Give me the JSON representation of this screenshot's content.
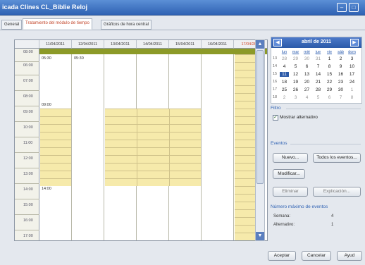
{
  "window": {
    "title": "icada Clines CL_Biblie Reloj"
  },
  "tabs": [
    {
      "label": "General"
    },
    {
      "label": "Tratamiento del módulo de tiempo"
    },
    {
      "label": "Gráficos de hora central"
    }
  ],
  "calendar": {
    "columns": [
      "11/04/2011",
      "12/04/2011",
      "13/04/2011",
      "14/04/2011",
      "15/04/2011",
      "16/04/2011",
      "17/04/2011"
    ],
    "hours": [
      "08:00",
      "06:00",
      "07:00",
      "08:00",
      "09:00",
      "10:00",
      "11:00",
      "12:00",
      "13:00",
      "14:00",
      "15:00",
      "16:00",
      "17:00"
    ],
    "events": {
      "mon_0530": "05:30",
      "tue_0530": "05:30",
      "mon_0900": "09:00",
      "mon_1400": "14:00"
    },
    "colors": {
      "work_band": "#f6eaab",
      "top_band": "#8c9a28",
      "today_header": "#d04020"
    }
  },
  "mini_calendar": {
    "title": "abril de 2011",
    "prev_icon": "chevron-left-icon",
    "next_icon": "chevron-right-icon",
    "weekdays": [
      "lun",
      "mar",
      "mié",
      "jue",
      "vie",
      "sáb",
      "dom"
    ],
    "weeks": [
      {
        "week": "13",
        "days": [
          "28",
          "29",
          "30",
          "31",
          "1",
          "2",
          "3"
        ]
      },
      {
        "week": "14",
        "days": [
          "4",
          "5",
          "6",
          "7",
          "8",
          "9",
          "10"
        ]
      },
      {
        "week": "15",
        "days": [
          "11",
          "12",
          "13",
          "14",
          "15",
          "16",
          "17"
        ]
      },
      {
        "week": "16",
        "days": [
          "18",
          "19",
          "20",
          "21",
          "22",
          "23",
          "24"
        ]
      },
      {
        "week": "17",
        "days": [
          "25",
          "26",
          "27",
          "28",
          "29",
          "30",
          "1"
        ]
      },
      {
        "week": "18",
        "days": [
          "2",
          "3",
          "4",
          "5",
          "6",
          "7",
          "8"
        ]
      }
    ],
    "selected_day": "11"
  },
  "filters": {
    "title": "Filtro",
    "show_alternative_label": "Mostrar alternativo",
    "show_alternative_checked": true
  },
  "events_panel": {
    "title": "Eventos",
    "new_label": "Nuevo...",
    "all_events_label": "Todos los eventos...",
    "modify_label": "Modificar...",
    "delete_label": "Eliminar",
    "explain_label": "Explicación..."
  },
  "max_events": {
    "title": "Número máximo de eventos",
    "week_label": "Semana:",
    "week_value": "4",
    "alternative_label": "Alternativo:",
    "alternative_value": "1"
  },
  "footer": {
    "accept_label": "Aceptar",
    "cancel_label": "Cancelar",
    "help_label": "Ayud"
  }
}
